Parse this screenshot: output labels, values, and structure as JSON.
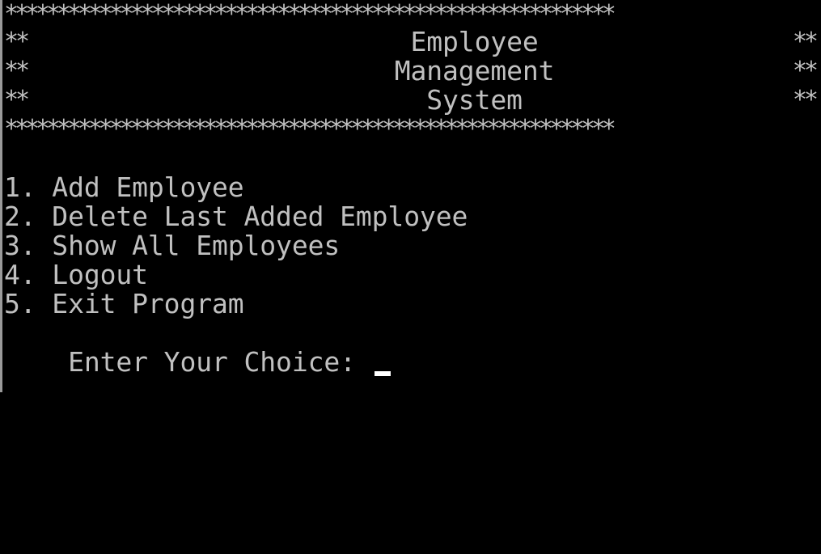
{
  "banner": {
    "border": "**********************************************************",
    "side_marker": "**",
    "title_lines": [
      "Employee",
      "Management",
      "System"
    ]
  },
  "menu": {
    "items": [
      "1. Add Employee",
      "2. Delete Last Added Employee",
      "3. Show All Employees",
      "4. Logout",
      "5. Exit Program"
    ]
  },
  "prompt": {
    "text": "Enter Your Choice: "
  },
  "colors": {
    "background": "#000000",
    "text": "#c0c0c0",
    "cursor": "#ffffff"
  }
}
